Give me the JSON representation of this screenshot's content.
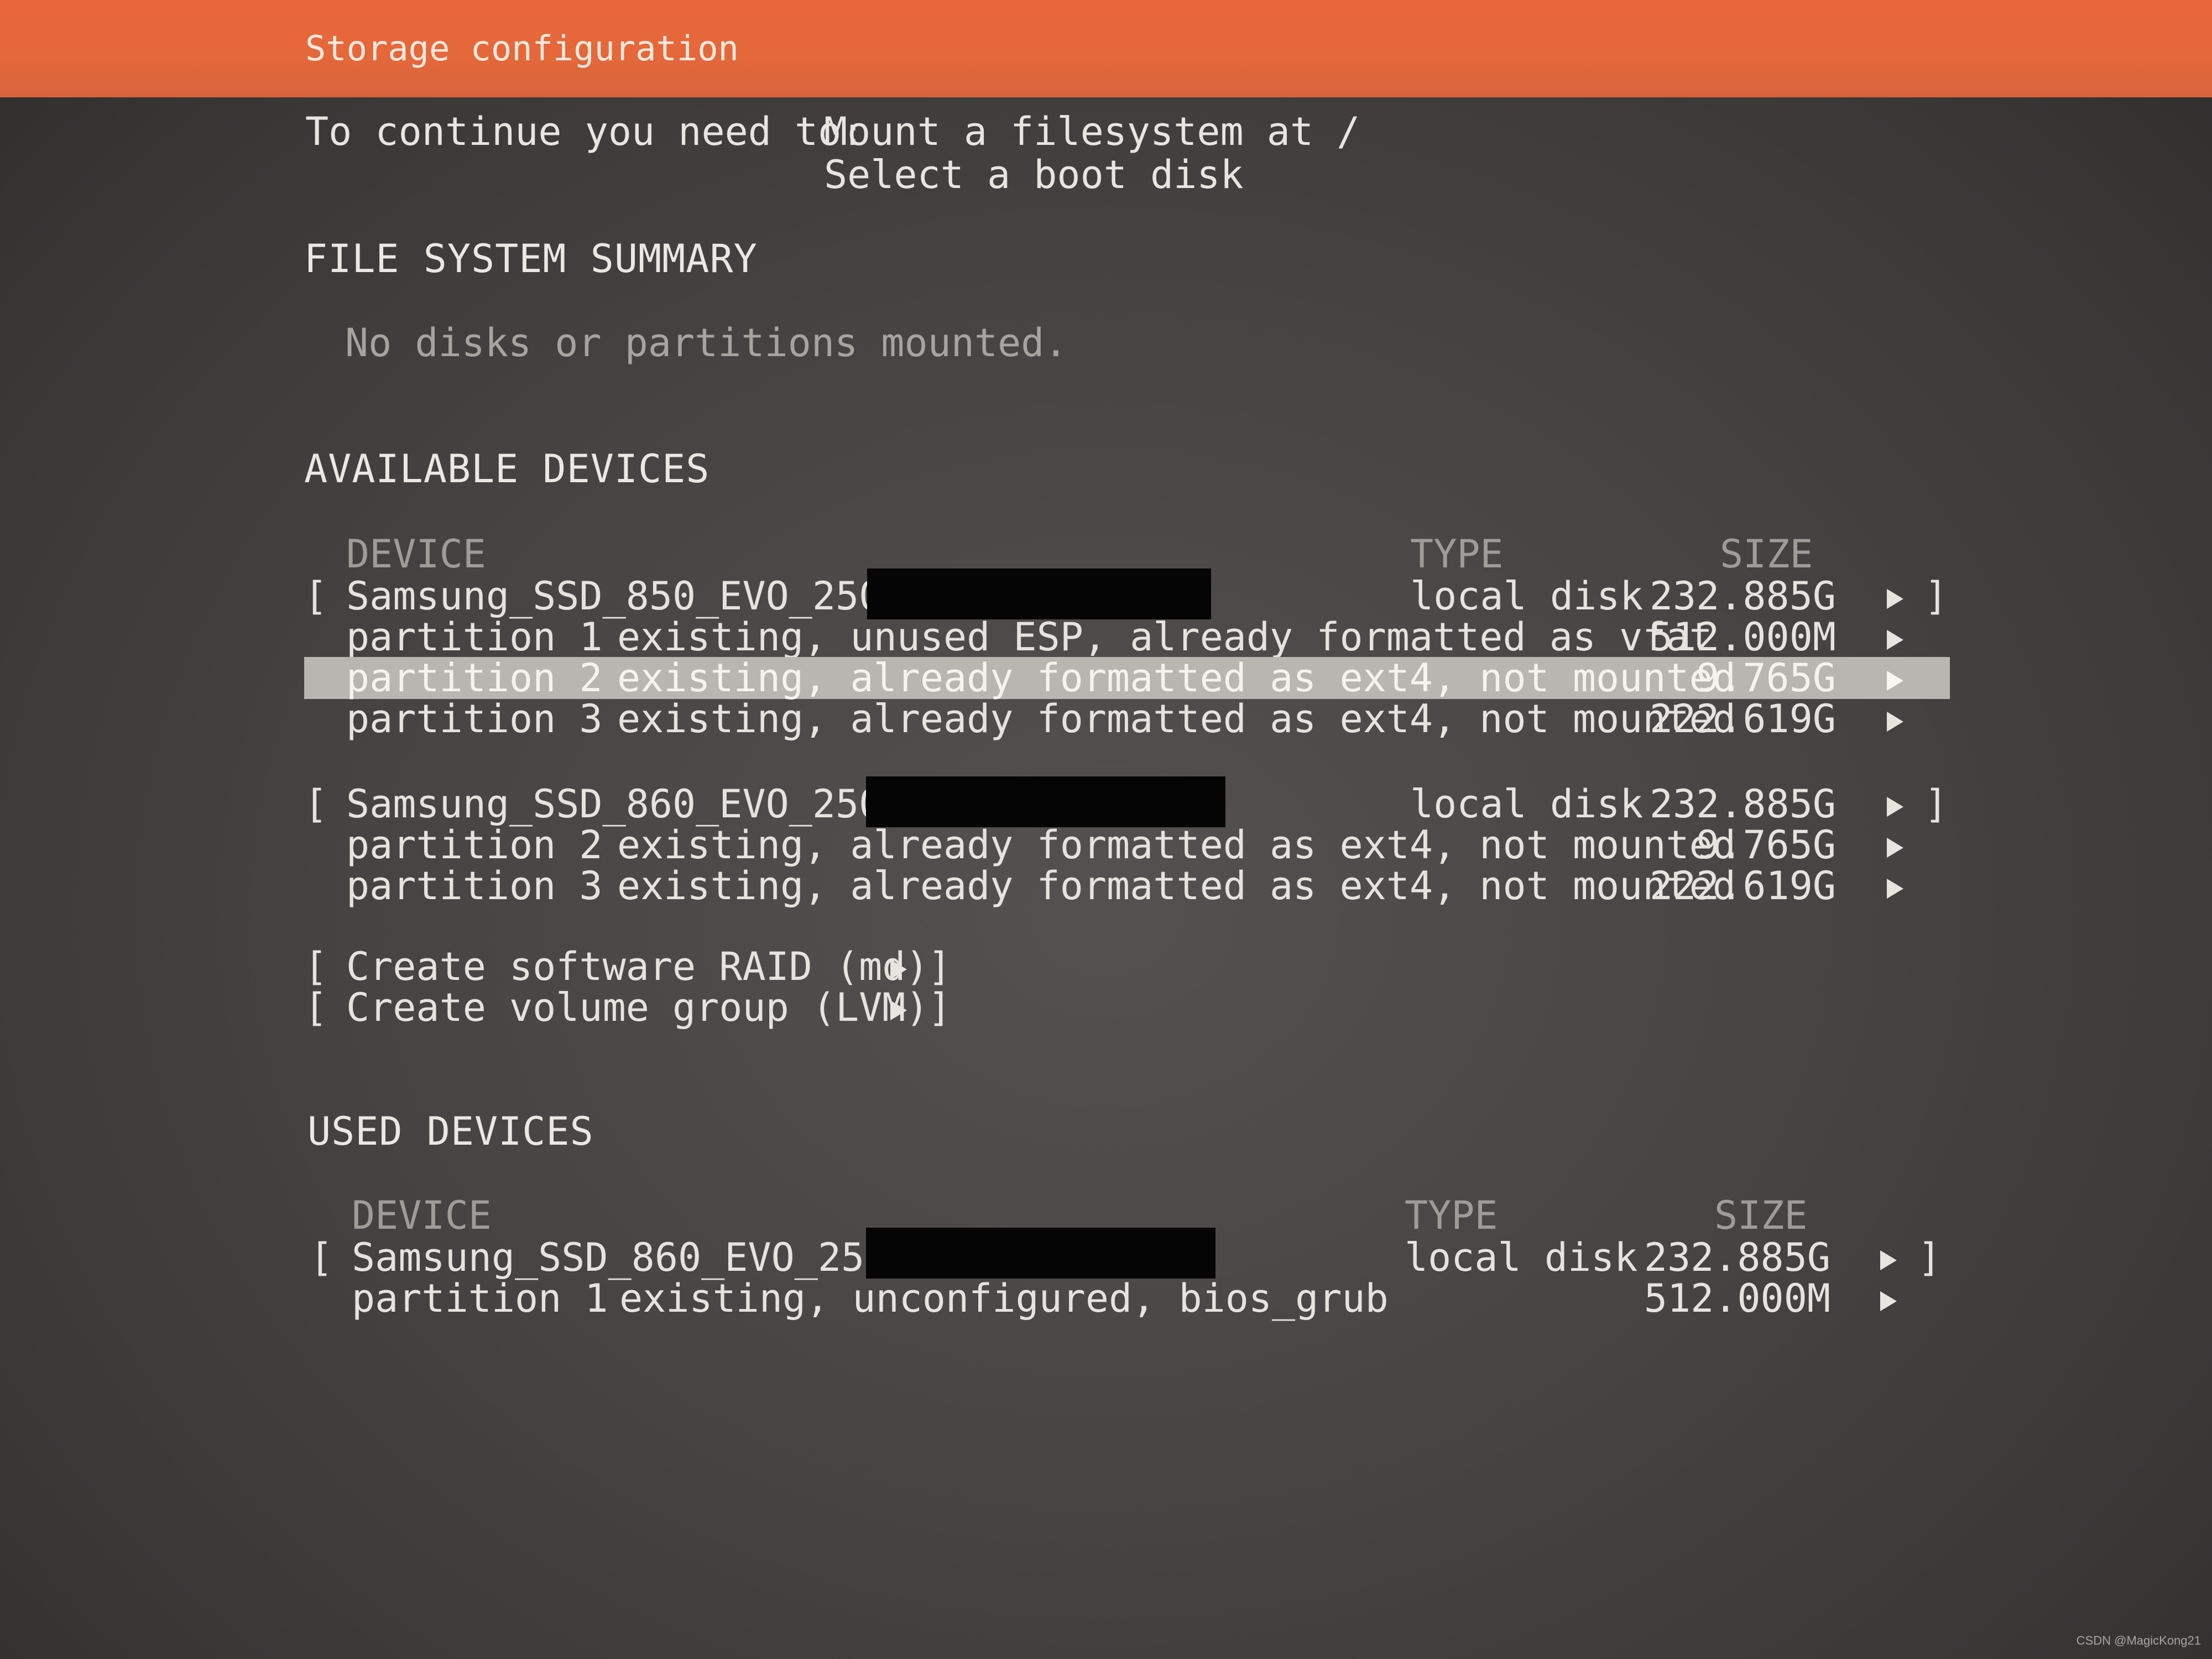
{
  "title": "Storage configuration",
  "continue": {
    "prefix": "To continue you need to:",
    "items": [
      "Mount a filesystem at /",
      "Select a boot disk"
    ]
  },
  "fs_summary": {
    "heading": "FILE SYSTEM SUMMARY",
    "empty_text": "No disks or partitions mounted."
  },
  "available": {
    "heading": "AVAILABLE DEVICES",
    "col_device": "DEVICE",
    "col_type": "TYPE",
    "col_size": "SIZE",
    "disks": [
      {
        "open_bracket": "[",
        "name": "Samsung_SSD_850_EVO_250GB",
        "type": "local disk",
        "size": "232.885G",
        "close_bracket": "]",
        "partitions": [
          {
            "label": "partition 1",
            "desc": "existing, unused ESP, already formatted as vfat",
            "size": "512.000M"
          },
          {
            "label": "partition 2",
            "desc": "existing, already formatted as ext4, not mounted",
            "size": "9.765G",
            "selected": true
          },
          {
            "label": "partition 3",
            "desc": "existing, already formatted as ext4, not mounted",
            "size": "222.619G"
          }
        ]
      },
      {
        "open_bracket": "[",
        "name": "Samsung_SSD_860_EVO_250GB",
        "type": "local disk",
        "size": "232.885G",
        "close_bracket": "]",
        "partitions": [
          {
            "label": "partition 2",
            "desc": "existing, already formatted as ext4, not mounted",
            "size": "9.765G"
          },
          {
            "label": "partition 3",
            "desc": "existing, already formatted as ext4, not mounted",
            "size": "222.619G"
          }
        ]
      }
    ],
    "actions": [
      {
        "open_bracket": "[",
        "label": "Create software RAID (md)",
        "close_bracket": "]"
      },
      {
        "open_bracket": "[",
        "label": "Create volume group (LVM)",
        "close_bracket": "]"
      }
    ]
  },
  "used": {
    "heading": "USED DEVICES",
    "col_device": "DEVICE",
    "col_type": "TYPE",
    "col_size": "SIZE",
    "disks": [
      {
        "open_bracket": "[",
        "name": "Samsung_SSD_860_EVO_250GB",
        "type": "local disk",
        "size": "232.885G",
        "close_bracket": "]",
        "partitions": [
          {
            "label": "partition 1",
            "desc": "existing, unconfigured, bios_grub",
            "size": "512.000M"
          }
        ]
      }
    ]
  },
  "watermark": "CSDN @MagicKong21",
  "colors": {
    "title_bar": "#e5683a",
    "background": "#474443",
    "selected_row": "#b9b6b2",
    "redaction": "#050505"
  },
  "icons": {
    "row_arrow": "arrow-right-icon"
  }
}
